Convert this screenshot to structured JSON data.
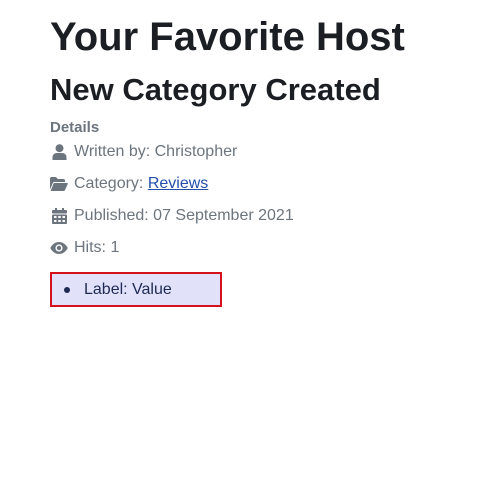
{
  "site": {
    "title": "Your Favorite Host"
  },
  "article": {
    "title": "New Category Created",
    "details_heading": "Details",
    "author_text": "Written by: Christopher",
    "category_prefix": "Category: ",
    "category_link": "Reviews",
    "published_text": "Published: 07 September 2021",
    "hits_text": "Hits: 1"
  },
  "fields": [
    {
      "text": "Label: Value"
    }
  ],
  "icons": {
    "author": "user-icon",
    "category": "folder-open-icon",
    "published": "calendar-icon",
    "hits": "eye-icon"
  },
  "colors": {
    "meta_text": "#6c757d",
    "link": "#224faa",
    "field_border": "#d5121b",
    "field_background": "#e1e1fa"
  }
}
